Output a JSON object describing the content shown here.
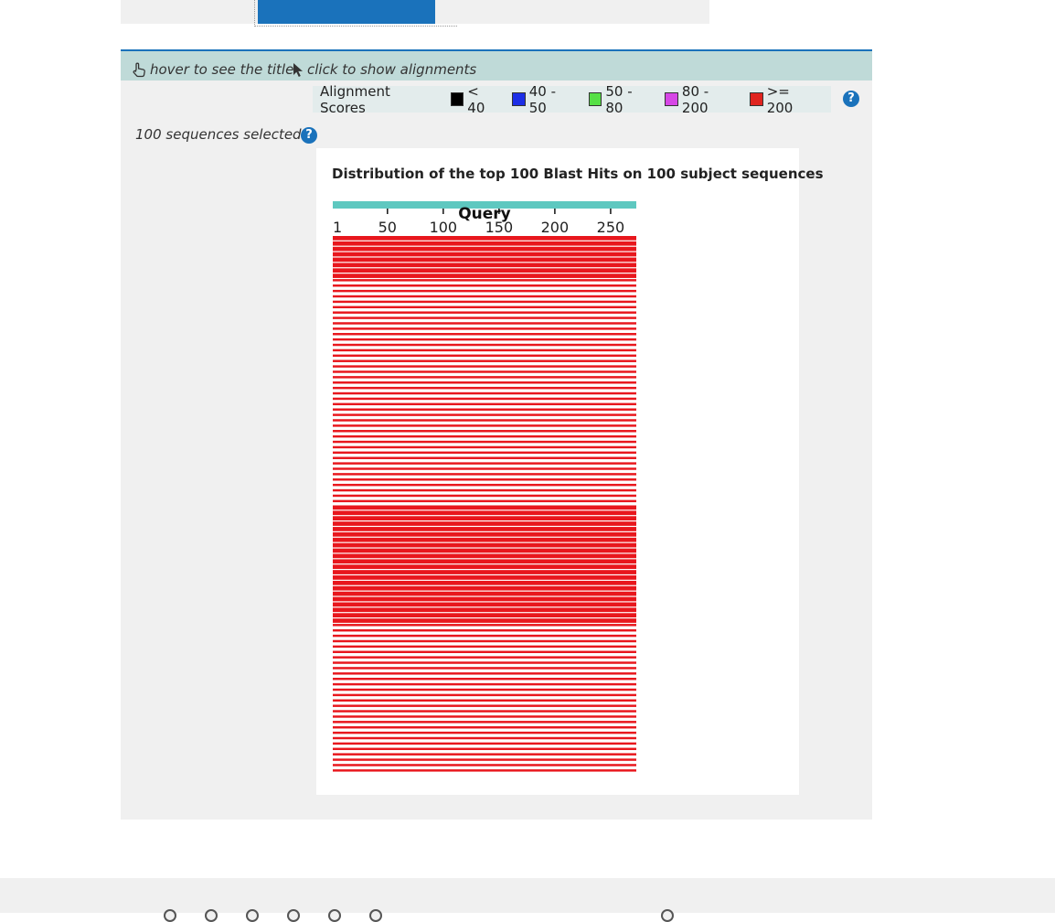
{
  "hint_bar": {
    "hover_text": "hover to see the title",
    "click_text": "click to show alignments"
  },
  "legend": {
    "title": "Alignment Scores",
    "items": [
      {
        "label": "< 40",
        "color": "#000000"
      },
      {
        "label": "40 - 50",
        "color": "#1c2ee6"
      },
      {
        "label": "50 - 80",
        "color": "#56e046"
      },
      {
        "label": "80 - 200",
        "color": "#d647e6"
      },
      {
        "label": ">= 200",
        "color": "#e0241f"
      }
    ]
  },
  "selection": {
    "text": "100 sequences selected"
  },
  "help_icon_symbol": "?",
  "chart_data": {
    "type": "bar",
    "title": "Distribution of the top 100 Blast Hits on 100 subject sequences",
    "query_label": "Query",
    "query_length": 273,
    "ticks": [
      "1",
      "50",
      "100",
      "150",
      "200",
      "250"
    ],
    "tick_values": [
      1,
      50,
      100,
      150,
      200,
      250
    ],
    "query_color": "#5ec8c0",
    "hit_color": "#e8171d",
    "hit_count": 100,
    "hits": [
      {
        "start": 1,
        "end": 273,
        "score_class": ">= 200"
      }
    ]
  },
  "footer": {
    "icons": [
      "circle-icon",
      "circle-icon",
      "circle-icon",
      "circle-icon",
      "circle-icon",
      "circle-icon",
      "circle-icon"
    ]
  }
}
